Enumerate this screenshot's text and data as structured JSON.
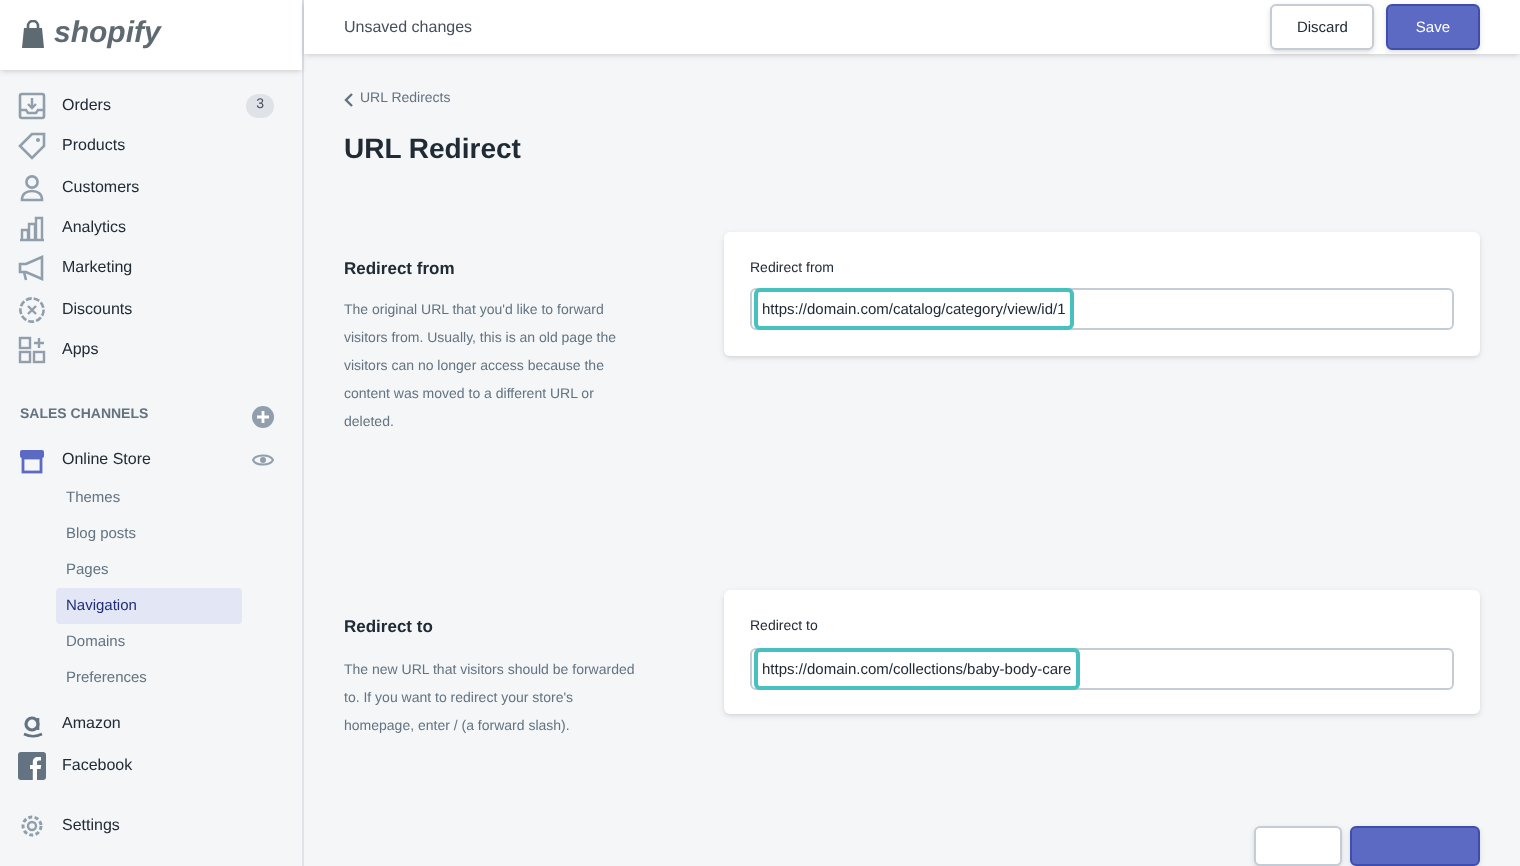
{
  "logo": {
    "text": "shopify"
  },
  "sidebar": {
    "items": [
      {
        "kind": "orders",
        "label": "Orders",
        "badge": "3"
      },
      {
        "kind": "products",
        "label": "Products"
      },
      {
        "kind": "customers",
        "label": "Customers"
      },
      {
        "kind": "analytics",
        "label": "Analytics"
      },
      {
        "kind": "marketing",
        "label": "Marketing"
      },
      {
        "kind": "discounts",
        "label": "Discounts"
      },
      {
        "kind": "apps",
        "label": "Apps"
      }
    ],
    "sales_channels": {
      "heading": "SALES CHANNELS",
      "store": {
        "label": "Online Store",
        "children": [
          {
            "label": "Themes",
            "selected": false
          },
          {
            "label": "Blog posts",
            "selected": false
          },
          {
            "label": "Pages",
            "selected": false
          },
          {
            "label": "Navigation",
            "selected": true
          },
          {
            "label": "Domains",
            "selected": false
          },
          {
            "label": "Preferences",
            "selected": false
          }
        ]
      },
      "channels": [
        {
          "kind": "amazon",
          "label": "Amazon"
        },
        {
          "kind": "facebook",
          "label": "Facebook"
        }
      ]
    },
    "settings": {
      "label": "Settings"
    }
  },
  "topbar": {
    "title": "Unsaved changes",
    "buttons": [
      {
        "kind": "secondary",
        "label": "Discard"
      },
      {
        "kind": "primary",
        "label": "Save"
      }
    ]
  },
  "breadcrumb": "URL Redirects",
  "title": "URL Redirect",
  "sections": [
    {
      "title": "Redirect from",
      "description": "The original URL that you'd like to forward visitors from. Usually, this is an old page the visitors can no longer access because the content was moved to a different URL or deleted.",
      "field": {
        "label": "Redirect from",
        "value": "https://domain.com/catalog/category/view/id/1",
        "focused": true
      }
    },
    {
      "title": "Redirect to",
      "description": "The new URL that visitors should be forwarded to. If you want to redirect your store's homepage, enter / (a forward slash).",
      "field": {
        "label": "Redirect to",
        "value": "https://domain.com/collections/baby-body-care",
        "focused": true
      }
    }
  ],
  "footer_buttons": [
    {
      "kind": "secondary"
    },
    {
      "kind": "primary"
    }
  ]
}
